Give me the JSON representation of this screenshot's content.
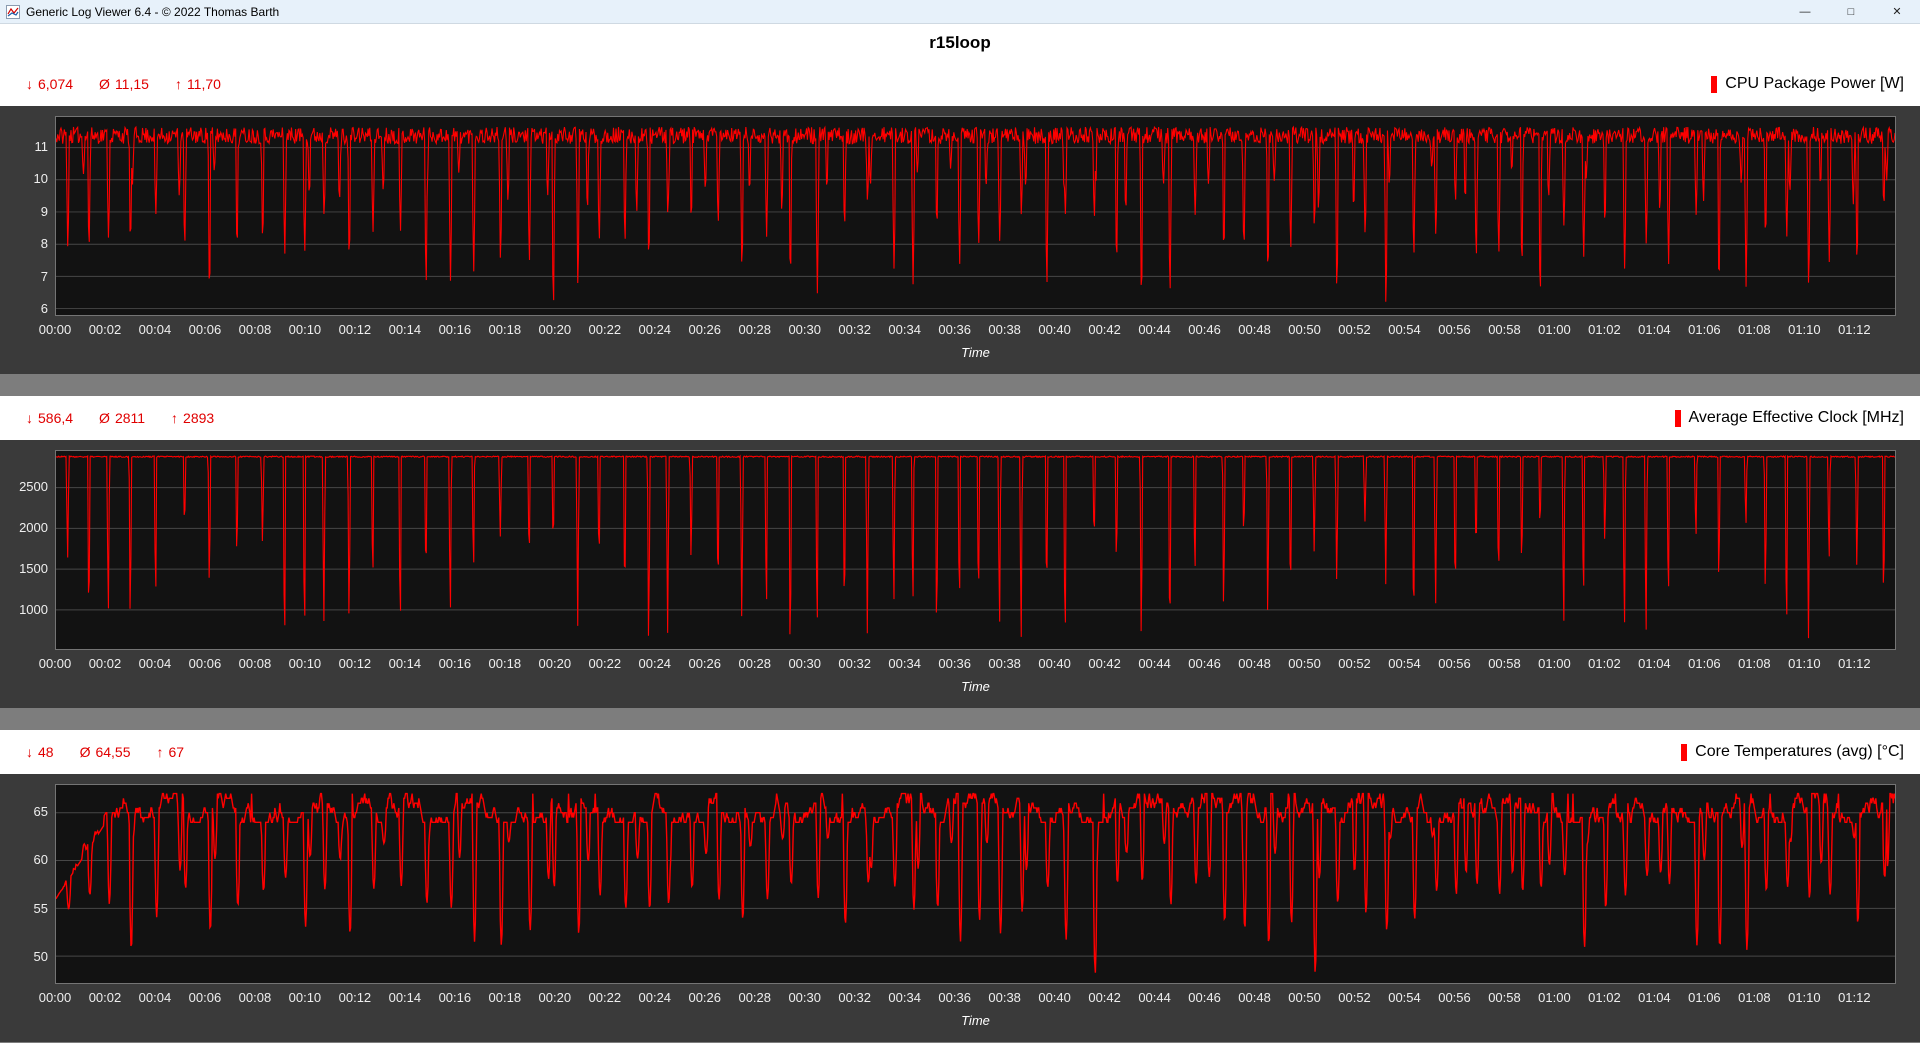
{
  "window": {
    "title": "Generic Log Viewer 6.4 - © 2022 Thomas Barth",
    "controls": {
      "minimize": "—",
      "maximize": "□",
      "close": "✕"
    }
  },
  "page_title": "r15loop",
  "time_axis_label": "Time",
  "symbols": {
    "min": "↓",
    "avg": "Ø",
    "max": "↑"
  },
  "x_ticks": [
    "00:00",
    "00:02",
    "00:04",
    "00:06",
    "00:08",
    "00:10",
    "00:12",
    "00:14",
    "00:16",
    "00:18",
    "00:20",
    "00:22",
    "00:24",
    "00:26",
    "00:28",
    "00:30",
    "00:32",
    "00:34",
    "00:36",
    "00:38",
    "00:40",
    "00:42",
    "00:44",
    "00:46",
    "00:48",
    "00:50",
    "00:52",
    "00:54",
    "00:56",
    "00:58",
    "01:00",
    "01:02",
    "01:04",
    "01:06",
    "01:08",
    "01:10",
    "01:12"
  ],
  "chart_defaults": {
    "duration_s": 4420,
    "sample_s": 2,
    "x_tick_interval_s": 120,
    "grid": "horizontal",
    "legend_position": "top-right",
    "plot_background": "#121212"
  },
  "chart_data": [
    {
      "type": "line",
      "title": "CPU Package Power [W]",
      "color": "#ff0000",
      "accent_text_color": "#e00000",
      "stats": {
        "min": "6,074",
        "avg": "11,15",
        "max": "11,70"
      },
      "stats_numeric": {
        "min": 6.074,
        "avg": 11.15,
        "max": 11.7
      },
      "ylim": [
        5.8,
        11.95
      ],
      "y_ticks": [
        6,
        7,
        8,
        9,
        10,
        11
      ],
      "series": {
        "name": "CPU Package Power",
        "baseline": 11.38,
        "noise": 0.26,
        "dip_len_s": 6,
        "dip_min": 6.3,
        "dip_max": 9.4,
        "deep_dip_indices": [
          20,
          55
        ],
        "deep_dip_value": 6.074,
        "extra_dip_min": 8.9,
        "extra_dip_max": 10.4,
        "seed": 11
      }
    },
    {
      "type": "line",
      "title": "Average Effective Clock [MHz]",
      "color": "#ff0000",
      "accent_text_color": "#e00000",
      "stats": {
        "min": "586,4",
        "avg": "2811",
        "max": "2893"
      },
      "stats_numeric": {
        "min": 586.4,
        "avg": 2811,
        "max": 2893
      },
      "ylim": [
        520,
        2950
      ],
      "y_ticks": [
        1000,
        1500,
        2000,
        2500
      ],
      "series": {
        "name": "Average Effective Clock",
        "baseline": 2880,
        "noise": 8,
        "dip_len_s": 5,
        "dip_min": 640,
        "dip_max": 2250,
        "deep_dip_indices": [
          30
        ],
        "deep_dip_value": 586.4,
        "seed": 22
      }
    },
    {
      "type": "line",
      "title": "Core Temperatures (avg) [°C]",
      "color": "#ff0000",
      "accent_text_color": "#e00000",
      "stats": {
        "min": "48",
        "avg": "64,55",
        "max": "67"
      },
      "stats_numeric": {
        "min": 48,
        "avg": 64.55,
        "max": 67
      },
      "ylim": [
        47.2,
        67.9
      ],
      "y_ticks": [
        50,
        55,
        60,
        65
      ],
      "series": {
        "name": "Core Temperatures (avg)",
        "baseline": 65.3,
        "walk": 1.5,
        "walk_clamp": 1.5,
        "quantize": 0.5,
        "dip_len_s": 10,
        "dip_min": 50.5,
        "dip_max": 58.5,
        "deep_dip_indices": [
          43,
          52
        ],
        "deep_dip_value": 48.2,
        "extra_dip_min": 58,
        "extra_dip_max": 62.5,
        "ramp_from": 56,
        "ramp_t": 120,
        "top_spike": 66.9,
        "seed": 33
      }
    }
  ]
}
